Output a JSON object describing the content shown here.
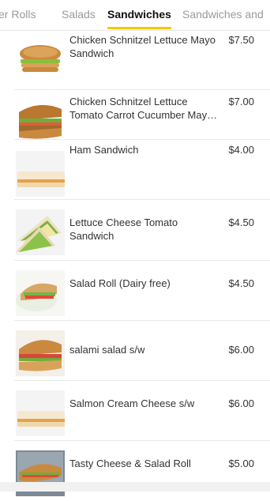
{
  "tabs": [
    {
      "label": "er Rolls",
      "active": false
    },
    {
      "label": "Salads",
      "active": false
    },
    {
      "label": "Sandwiches",
      "active": true
    },
    {
      "label": "Sandwiches and",
      "active": false
    }
  ],
  "items": [
    {
      "name": "Chicken Schnitzel Lettuce Mayo Sandwich",
      "price": "$7.50",
      "image_icon": "burger-sandwich-photo-icon"
    },
    {
      "name": "Chicken Schnitzel Lettuce Tomato Carrot Cucumber Mayo Sandwich",
      "price": "$7.00",
      "image_icon": "schnitzel-roll-photo-icon"
    },
    {
      "name": "Ham Sandwich",
      "price": "$4.00",
      "image_icon": "bread-slice-photo-icon"
    },
    {
      "name": "Lettuce Cheese Tomato Sandwich",
      "price": "$4.50",
      "image_icon": "triangle-sandwich-photo-icon"
    },
    {
      "name": "Salad Roll (Dairy free)",
      "price": "$4.50",
      "image_icon": "salad-roll-photo-icon"
    },
    {
      "name": "salami salad s/w",
      "price": "$6.00",
      "image_icon": "salami-roll-photo-icon"
    },
    {
      "name": "Salmon Cream Cheese s/w",
      "price": "$6.00",
      "image_icon": "bread-slice-photo-icon"
    },
    {
      "name": "Tasty Cheese & Salad Roll",
      "price": "$5.00",
      "image_icon": "baguette-photo-icon"
    }
  ]
}
